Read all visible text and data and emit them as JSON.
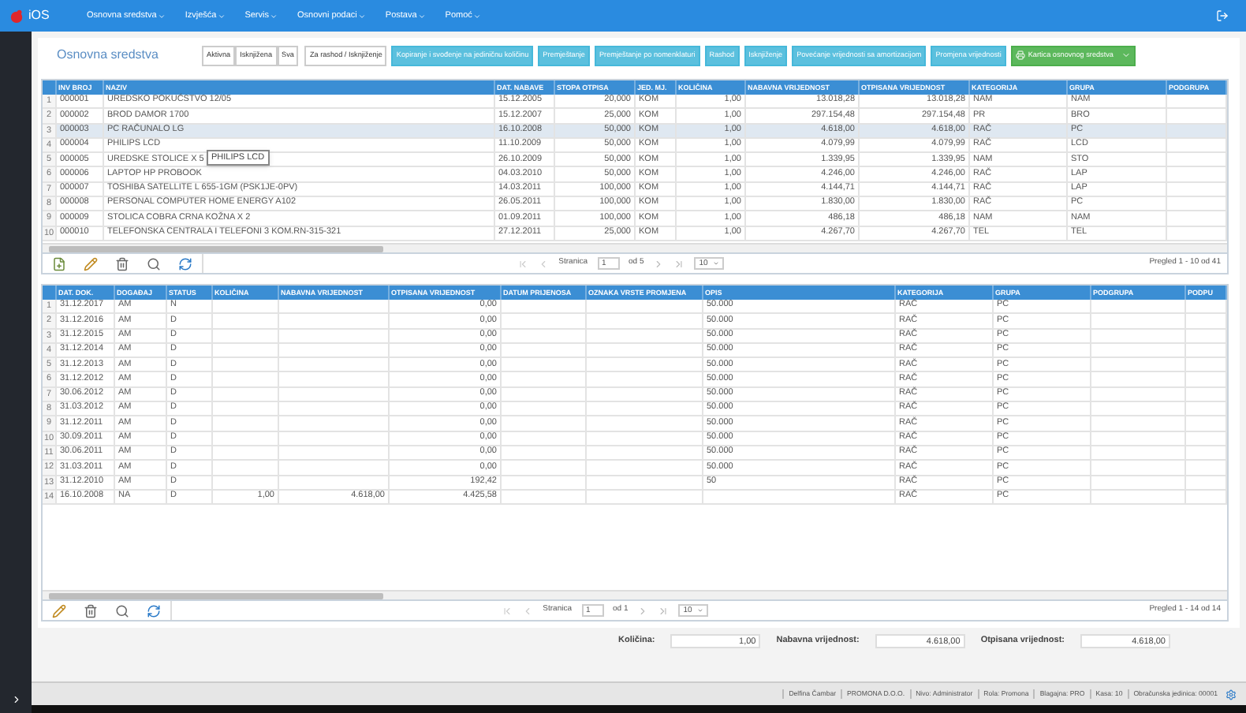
{
  "nav": {
    "logo": "iOS",
    "menus": [
      "Osnovna sredstva",
      "Izvješća",
      "Servis",
      "Osnovni podaci",
      "Postava",
      "Pomoć"
    ]
  },
  "page_title": "Osnovna sredstva",
  "toolbar": [
    {
      "kind": "filter",
      "label": "Aktivna"
    },
    {
      "kind": "filter",
      "label": "Isknjižena"
    },
    {
      "kind": "filter",
      "label": "Sva"
    },
    {
      "kind": "plain",
      "label": "Za rashod / Isknjiženje"
    },
    {
      "kind": "action",
      "label": "Kopiranje i svođenje na jediničnu količinu"
    },
    {
      "kind": "action",
      "label": "Premještanje"
    },
    {
      "kind": "action",
      "label": "Premještanje po nomenklaturi"
    },
    {
      "kind": "action",
      "label": "Rashod"
    },
    {
      "kind": "action",
      "label": "Isknjiženje"
    },
    {
      "kind": "action",
      "label": "Povećanje vrijednosti sa amortizacijom"
    },
    {
      "kind": "action",
      "label": "Promjena vrijednosti"
    },
    {
      "kind": "primary",
      "label": "Kartica osnovnog sredstva"
    }
  ],
  "assets_table": {
    "columns": [
      "INV BROJ",
      "NAZIV",
      "DAT. NABAVE",
      "STOPA OTPISA",
      "JED. MJ.",
      "KOLIČINA",
      "NABAVNA VRIJEDNOST",
      "OTPISANA VRIJEDNOST",
      "KATEGORIJA",
      "GRUPA",
      "PODGRUPA"
    ],
    "rows": [
      {
        "n": "1",
        "selected": false,
        "cells": [
          "000001",
          "UREDSKO POKUĆSTVO 12/05",
          "15.12.2005",
          "20,000",
          "KOM",
          "1,00",
          "13.018,28",
          "13.018,28",
          "NAM",
          "NAM",
          ""
        ]
      },
      {
        "n": "2",
        "selected": false,
        "cells": [
          "000002",
          "BROD DAMOR 1700",
          "15.12.2007",
          "25,000",
          "KOM",
          "1,00",
          "297.154,48",
          "297.154,48",
          "PR",
          "BRO",
          ""
        ]
      },
      {
        "n": "3",
        "selected": true,
        "cells": [
          "000003",
          "PC RAČUNALO LG",
          "16.10.2008",
          "50,000",
          "KOM",
          "1,00",
          "4.618,00",
          "4.618,00",
          "RAČ",
          "PC",
          ""
        ]
      },
      {
        "n": "4",
        "selected": false,
        "cells": [
          "000004",
          "PHILIPS LCD",
          "11.10.2009",
          "50,000",
          "KOM",
          "1,00",
          "4.079,99",
          "4.079,99",
          "RAČ",
          "LCD",
          ""
        ]
      },
      {
        "n": "5",
        "selected": false,
        "cells": [
          "000005",
          "UREDSKE STOLICE X 5",
          "26.10.2009",
          "50,000",
          "KOM",
          "1,00",
          "1.339,95",
          "1.339,95",
          "NAM",
          "STO",
          ""
        ]
      },
      {
        "n": "6",
        "selected": false,
        "cells": [
          "000006",
          "LAPTOP HP PROBOOK",
          "04.03.2010",
          "50,000",
          "KOM",
          "1,00",
          "4.246,00",
          "4.246,00",
          "RAČ",
          "LAP",
          ""
        ]
      },
      {
        "n": "7",
        "selected": false,
        "cells": [
          "000007",
          "TOSHIBA SATELLITE L 655-1GM (PSK1JE-0PV)",
          "14.03.2011",
          "100,000",
          "KOM",
          "1,00",
          "4.144,71",
          "4.144,71",
          "RAČ",
          "LAP",
          ""
        ]
      },
      {
        "n": "8",
        "selected": false,
        "cells": [
          "000008",
          "PERSONAL COMPUTER HOME ENERGY A102",
          "26.05.2011",
          "100,000",
          "KOM",
          "1,00",
          "1.830,00",
          "1.830,00",
          "RAČ",
          "PC",
          ""
        ]
      },
      {
        "n": "9",
        "selected": false,
        "cells": [
          "000009",
          "STOLICA COBRA CRNA KOŽNA X 2",
          "01.09.2011",
          "100,000",
          "KOM",
          "1,00",
          "486,18",
          "486,18",
          "NAM",
          "NAM",
          ""
        ]
      },
      {
        "n": "10",
        "selected": false,
        "cells": [
          "000010",
          "TELEFONSKA CENTRALA I TELEFONI 3 KOM.RN-315-321",
          "27.12.2011",
          "25,000",
          "KOM",
          "1,00",
          "4.267,70",
          "4.267,70",
          "TEL",
          "TEL",
          ""
        ]
      }
    ],
    "tooltip": "PHILIPS LCD",
    "pager": {
      "page_label": "Stranica",
      "page": "1",
      "of": "od 5",
      "per_page": "10",
      "summary": "Pregled 1 - 10 od 41"
    }
  },
  "changes_table": {
    "columns": [
      "DAT. DOK.",
      "DOGAĐAJ",
      "STATUS",
      "KOLIČINA",
      "NABAVNA VRIJEDNOST",
      "OTPISANA VRIJEDNOST",
      "DATUM PRIJENOSA",
      "OZNAKA VRSTE PROMJENA",
      "OPIS",
      "KATEGORIJA",
      "GRUPA",
      "PODGRUPA",
      "PODPU"
    ],
    "rows": [
      {
        "n": "1",
        "cells": [
          "31.12.2017",
          "AM",
          "N",
          "",
          "",
          "0,00",
          "",
          "",
          "50.000",
          "RAČ",
          "PC",
          "",
          ""
        ]
      },
      {
        "n": "2",
        "cells": [
          "31.12.2016",
          "AM",
          "D",
          "",
          "",
          "0,00",
          "",
          "",
          "50.000",
          "RAČ",
          "PC",
          "",
          ""
        ]
      },
      {
        "n": "3",
        "cells": [
          "31.12.2015",
          "AM",
          "D",
          "",
          "",
          "0,00",
          "",
          "",
          "50.000",
          "RAČ",
          "PC",
          "",
          ""
        ]
      },
      {
        "n": "4",
        "cells": [
          "31.12.2014",
          "AM",
          "D",
          "",
          "",
          "0,00",
          "",
          "",
          "50.000",
          "RAČ",
          "PC",
          "",
          ""
        ]
      },
      {
        "n": "5",
        "cells": [
          "31.12.2013",
          "AM",
          "D",
          "",
          "",
          "0,00",
          "",
          "",
          "50.000",
          "RAČ",
          "PC",
          "",
          ""
        ]
      },
      {
        "n": "6",
        "cells": [
          "31.12.2012",
          "AM",
          "D",
          "",
          "",
          "0,00",
          "",
          "",
          "50.000",
          "RAČ",
          "PC",
          "",
          ""
        ]
      },
      {
        "n": "7",
        "cells": [
          "30.06.2012",
          "AM",
          "D",
          "",
          "",
          "0,00",
          "",
          "",
          "50.000",
          "RAČ",
          "PC",
          "",
          ""
        ]
      },
      {
        "n": "8",
        "cells": [
          "31.03.2012",
          "AM",
          "D",
          "",
          "",
          "0,00",
          "",
          "",
          "50.000",
          "RAČ",
          "PC",
          "",
          ""
        ]
      },
      {
        "n": "9",
        "cells": [
          "31.12.2011",
          "AM",
          "D",
          "",
          "",
          "0,00",
          "",
          "",
          "50.000",
          "RAČ",
          "PC",
          "",
          ""
        ]
      },
      {
        "n": "10",
        "cells": [
          "30.09.2011",
          "AM",
          "D",
          "",
          "",
          "0,00",
          "",
          "",
          "50.000",
          "RAČ",
          "PC",
          "",
          ""
        ]
      },
      {
        "n": "11",
        "cells": [
          "30.06.2011",
          "AM",
          "D",
          "",
          "",
          "0,00",
          "",
          "",
          "50.000",
          "RAČ",
          "PC",
          "",
          ""
        ]
      },
      {
        "n": "12",
        "cells": [
          "31.03.2011",
          "AM",
          "D",
          "",
          "",
          "0,00",
          "",
          "",
          "50.000",
          "RAČ",
          "PC",
          "",
          ""
        ]
      },
      {
        "n": "13",
        "cells": [
          "31.12.2010",
          "AM",
          "D",
          "",
          "",
          "192,42",
          "",
          "",
          "50",
          "RAČ",
          "PC",
          "",
          ""
        ]
      },
      {
        "n": "14",
        "cells": [
          "16.10.2008",
          "NA",
          "D",
          "1,00",
          "4.618,00",
          "4.425,58",
          "",
          "",
          "",
          "RAČ",
          "PC",
          "",
          ""
        ]
      }
    ],
    "pager": {
      "page_label": "Stranica",
      "page": "1",
      "of": "od 1",
      "per_page": "10",
      "summary": "Pregled 1 - 14 od 14"
    }
  },
  "totals": [
    {
      "label": "Količina:",
      "value": "1,00"
    },
    {
      "label": "Nabavna vrijednost:",
      "value": "4.618,00"
    },
    {
      "label": "Otpisana vrijednost:",
      "value": "4.618,00"
    }
  ],
  "status_bar": [
    "Delfina Čambar",
    "PROMONA D.O.O.",
    "Nivo: Administrator",
    "Rola: Promona",
    "Blagajna: PRO",
    "Kasa: 10",
    "Obračunska jedinica: 00001"
  ]
}
